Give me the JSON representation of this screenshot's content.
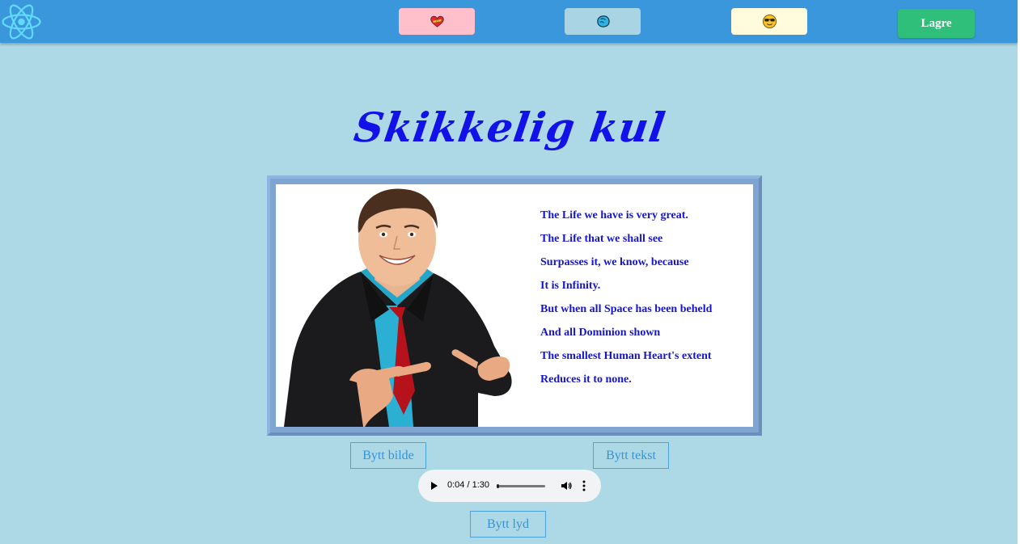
{
  "navbar": {
    "logo_icon": "react-atom-icon",
    "buttons": [
      {
        "icon": "heart-with-ribbon-icon",
        "color": "#ffc0cb"
      },
      {
        "icon": "oncoming-fist-icon",
        "color": "#a9d4e3"
      },
      {
        "icon": "smiling-face-with-sunglasses-icon",
        "color": "#fffbdc"
      }
    ],
    "save_label": "Lagre",
    "save_color": "#2fbf7a",
    "bar_color": "#3a97db"
  },
  "main": {
    "title": "Skikkelig kul",
    "title_color": "#1212e8",
    "poem": [
      "The Life we have is very great.",
      "The Life that we shall see",
      "Surpasses it, we know, because",
      "It is Infinity.",
      "But when all Space has been beheld",
      "And all Dominion shown",
      "The smallest Human Heart's extent",
      "Reduces it to none."
    ],
    "change_image_label": "Bytt bilde",
    "change_text_label": "Bytt tekst",
    "change_sound_label": "Bytt lyd"
  },
  "audio": {
    "time": "0:04 / 1:30",
    "progress_fraction": 0.044
  }
}
